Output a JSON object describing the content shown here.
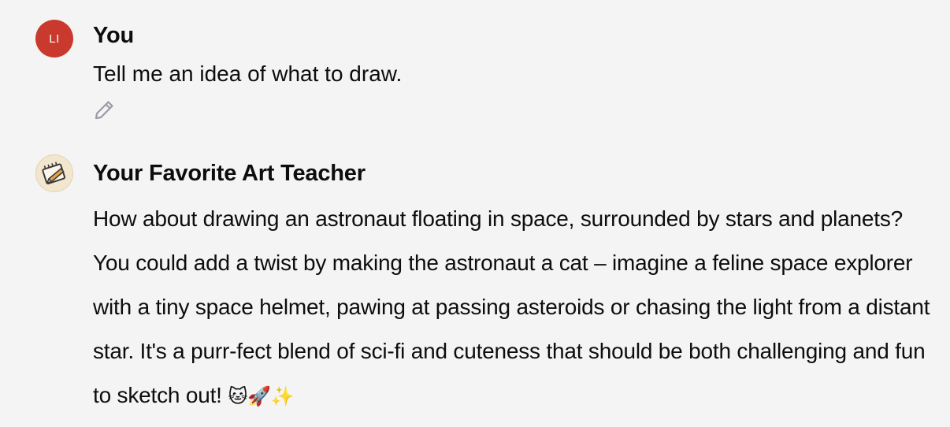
{
  "user_message": {
    "avatar_initials": "LI",
    "avatar_color": "#c9392d",
    "author": "You",
    "text": "Tell me an idea of what to draw.",
    "edit_icon": "pencil-icon"
  },
  "assistant_message": {
    "avatar_icon": "sketchbook-pencil-icon",
    "avatar_color": "#f3e6cf",
    "author": "Your Favorite Art Teacher",
    "text": "How about drawing an astronaut floating in space, surrounded by stars and planets? You could add a twist by making the astronaut a cat – imagine a feline space explorer with a tiny space helmet, pawing at passing asteroids or chasing the light from a distant star. It's a purr-fect blend of sci-fi and cuteness that should be both challenging and fun to sketch out!",
    "emojis": "🐱🚀✨"
  }
}
